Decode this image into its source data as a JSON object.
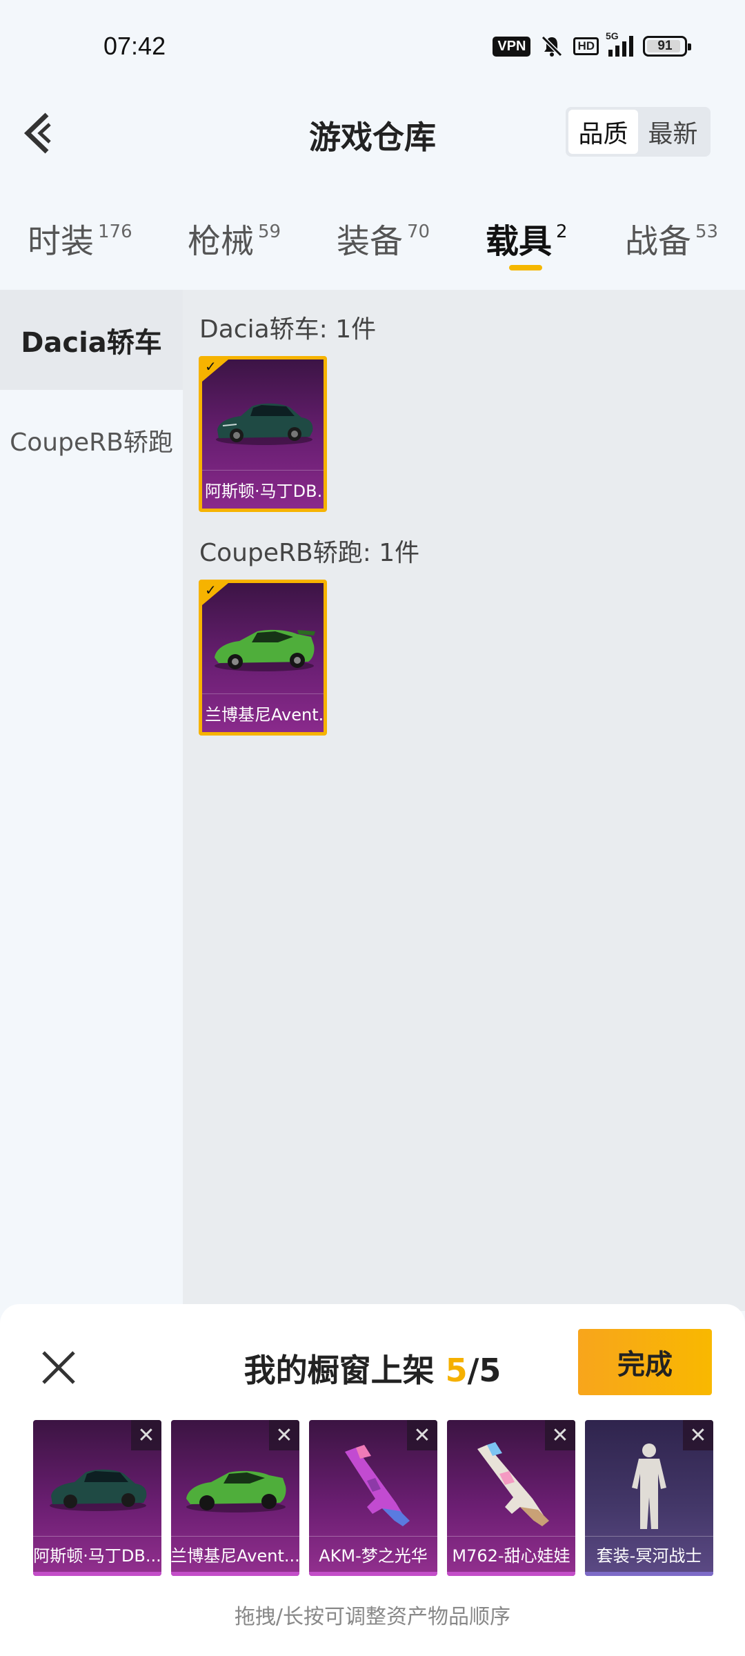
{
  "status_bar": {
    "time": "07:42",
    "vpn": "VPN",
    "hd": "HD",
    "network": "5G",
    "battery": "91"
  },
  "header": {
    "title": "游戏仓库",
    "sort_options": [
      "品质",
      "最新"
    ],
    "sort_selected": "品质"
  },
  "tabs": [
    {
      "label": "时装",
      "count": "176"
    },
    {
      "label": "枪械",
      "count": "59"
    },
    {
      "label": "装备",
      "count": "70"
    },
    {
      "label": "载具",
      "count": "2",
      "active": true
    },
    {
      "label": "战备",
      "count": "53"
    }
  ],
  "sidebar": {
    "items": [
      {
        "label": "Dacia轿车",
        "active": true
      },
      {
        "label": "CoupeRB轿跑"
      }
    ]
  },
  "groups": [
    {
      "title": "Dacia轿车: 1件",
      "items": [
        {
          "name": "阿斯顿·马丁DB...",
          "selected": true,
          "icon": "dark-green-sports-car"
        }
      ]
    },
    {
      "title": "CoupeRB轿跑: 1件",
      "items": [
        {
          "name": "兰博基尼Avent...",
          "selected": true,
          "icon": "green-supercar"
        }
      ]
    }
  ],
  "showcase": {
    "title": "我的橱窗上架",
    "count": "5",
    "max": "/5",
    "done_label": "完成",
    "slots": [
      {
        "name": "阿斯顿·马丁DB...",
        "icon": "dark-green-sports-car"
      },
      {
        "name": "兰博基尼Avent...",
        "icon": "green-supercar"
      },
      {
        "name": "AKM-梦之光华",
        "icon": "akm-rifle"
      },
      {
        "name": "M762-甜心娃娃",
        "icon": "m762-rifle"
      },
      {
        "name": "套装-冥河战士",
        "icon": "outfit-figure"
      }
    ],
    "hint": "拖拽/长按可调整资产物品顺序"
  },
  "colors": {
    "accent": "#f5b000",
    "epic_purple": "#6b1e72",
    "legendary_violet": "#433768"
  }
}
